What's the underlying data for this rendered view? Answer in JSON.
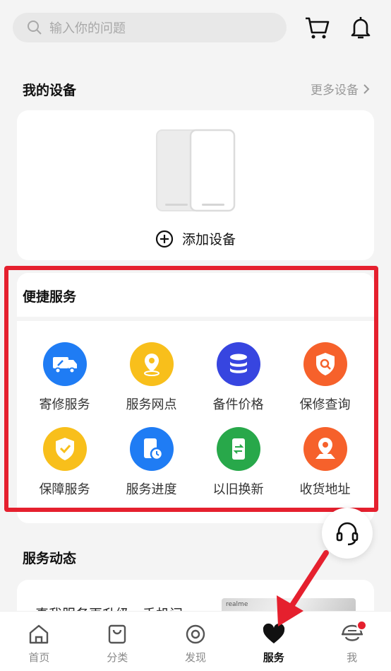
{
  "search": {
    "placeholder": "输入你的问题"
  },
  "my_devices": {
    "title": "我的设备",
    "more": "更多设备",
    "add_label": "添加设备"
  },
  "quick_services": {
    "title": "便捷服务",
    "items": [
      {
        "label": "寄修服务",
        "icon": "truck-wrench-icon",
        "color": "#1f7cf4"
      },
      {
        "label": "服务网点",
        "icon": "location-pin-icon",
        "color": "#f8bf1b"
      },
      {
        "label": "备件价格",
        "icon": "database-stack-icon",
        "color": "#3745e0"
      },
      {
        "label": "保修查询",
        "icon": "shield-search-icon",
        "color": "#f6612b"
      },
      {
        "label": "保障服务",
        "icon": "shield-check-icon",
        "color": "#f8bf1b"
      },
      {
        "label": "服务进度",
        "icon": "phone-clock-icon",
        "color": "#1f7cf4"
      },
      {
        "label": "以旧换新",
        "icon": "phone-exchange-icon",
        "color": "#28a84a"
      },
      {
        "label": "收货地址",
        "icon": "map-pin-icon",
        "color": "#f6612b"
      }
    ]
  },
  "service_news": {
    "title": "服务动态",
    "headline": "真我服务再升级，手机问",
    "image_brand": "realme"
  },
  "tabbar": {
    "items": [
      {
        "label": "首页",
        "icon": "home-icon"
      },
      {
        "label": "分类",
        "icon": "bag-icon"
      },
      {
        "label": "发现",
        "icon": "discover-icon"
      },
      {
        "label": "服务",
        "icon": "heart-icon",
        "active": true
      },
      {
        "label": "我",
        "icon": "profile-icon",
        "badge": true
      }
    ]
  },
  "colors": {
    "highlight": "#e5202e",
    "accent": "#e5202e"
  }
}
